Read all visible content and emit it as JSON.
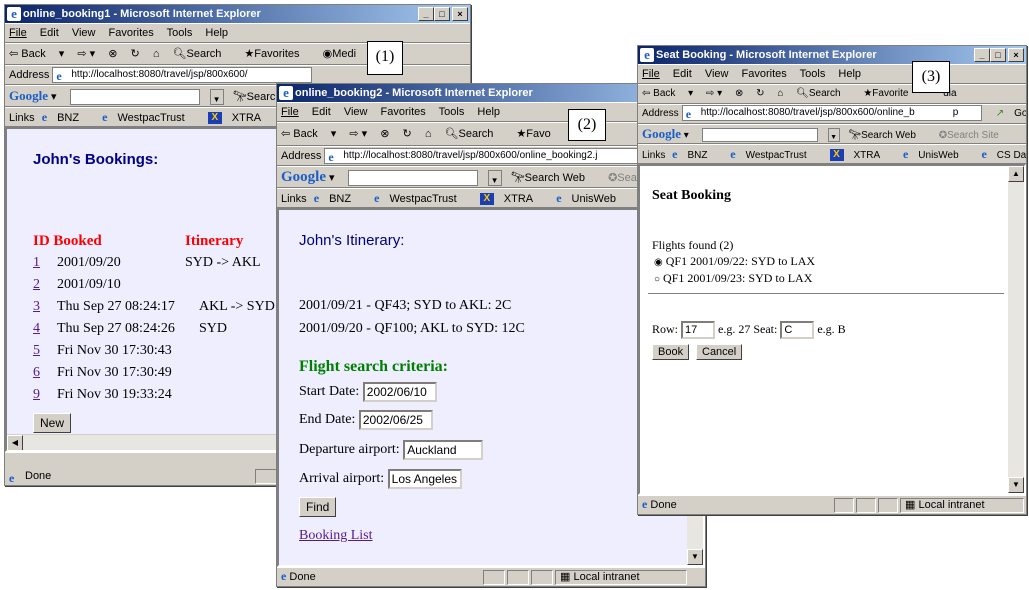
{
  "windows": {
    "w1": {
      "title": "online_booking1 - Microsoft Internet Explorer",
      "menu": [
        "File",
        "Edit",
        "View",
        "Favorites",
        "Tools",
        "Help"
      ],
      "toolbar": {
        "back": "Back",
        "search": "Search",
        "favorites": "Favorites",
        "media": "Medi"
      },
      "address": {
        "label": "Address",
        "url": "http://localhost:8080/travel/jsp/800x600/"
      },
      "google": {
        "logo": "Google",
        "search": "Search"
      },
      "links": {
        "label": "Links",
        "items": [
          "BNZ",
          "WestpacTrust",
          "XTRA"
        ]
      },
      "page": {
        "heading": "John's Bookings:",
        "col_id": "ID Booked",
        "col_itinerary": "Itinerary",
        "rows": [
          {
            "id": "1",
            "booked": "2001/09/20",
            "itinerary": "SYD -> AKL"
          },
          {
            "id": "2",
            "booked": "2001/09/10",
            "itinerary": ""
          },
          {
            "id": "3",
            "booked": "Thu Sep 27 08:24:17",
            "itinerary": "AKL -> SYD"
          },
          {
            "id": "4",
            "booked": "Thu Sep 27 08:24:26",
            "itinerary": "SYD"
          },
          {
            "id": "5",
            "booked": "Fri Nov 30 17:30:43",
            "itinerary": ""
          },
          {
            "id": "6",
            "booked": "Fri Nov 30 17:30:49",
            "itinerary": ""
          },
          {
            "id": "9",
            "booked": "Fri Nov 30 19:33:24",
            "itinerary": ""
          }
        ],
        "new_button": "New"
      },
      "status": "Done",
      "callout": "(1)"
    },
    "w2": {
      "title": "online_booking2 - Microsoft Internet Explorer",
      "menu": [
        "File",
        "Edit",
        "View",
        "Favorites",
        "Tools",
        "Help"
      ],
      "toolbar": {
        "back": "Back",
        "search": "Search",
        "favorites": "Favo",
        "media": "Me"
      },
      "address": {
        "label": "Address",
        "url": "http://localhost:8080/travel/jsp/800x600/online_booking2.j"
      },
      "google": {
        "logo": "Google",
        "search": "Search Web",
        "search_site": "Searc"
      },
      "links": {
        "label": "Links",
        "items": [
          "BNZ",
          "WestpacTrust",
          "XTRA",
          "UnisWeb"
        ]
      },
      "page": {
        "heading": "John's Itinerary:",
        "itinerary": [
          "2001/09/21 - QF43; SYD to AKL: 2C",
          "2001/09/20 - QF100; AKL to SYD: 12C"
        ],
        "criteria_heading": "Flight search criteria:",
        "start_label": "Start Date:",
        "start_value": "2002/06/10",
        "end_label": "End Date:",
        "end_value": "2002/06/25",
        "dep_label": "Departure airport:",
        "dep_value": "Auckland",
        "arr_label": "Arrival airport:",
        "arr_value": "Los Angeles",
        "find_button": "Find",
        "booking_list_link": "Booking List"
      },
      "status": "Done",
      "zone": "Local intranet",
      "callout": "(2)"
    },
    "w3": {
      "title": "Seat Booking - Microsoft Internet Explorer",
      "menu": [
        "File",
        "Edit",
        "View",
        "Favorites",
        "Tools",
        "Help"
      ],
      "toolbar": {
        "back": "Back",
        "search": "Search",
        "favorites": "Favorite",
        "media": "dia"
      },
      "address": {
        "label": "Address",
        "url": "http://localhost:8080/travel/jsp/800x600/online_b",
        "url_tail": "p",
        "go": "Go"
      },
      "google": {
        "logo": "Google",
        "search": "Search Web",
        "search_site": "Search Site"
      },
      "links": {
        "label": "Links",
        "items": [
          "BNZ",
          "WestpacTrust",
          "XTRA",
          "UnisWeb",
          "CS Databases"
        ]
      },
      "page": {
        "heading": "Seat Booking",
        "found": "Flights found (2)",
        "flights": [
          "QF1 2001/09/22: SYD to LAX",
          "QF1 2001/09/23: SYD to LAX"
        ],
        "row_label": "Row:",
        "row_value": "17",
        "row_hint": "e.g. 27",
        "seat_label": "Seat:",
        "seat_value": "C",
        "seat_hint": "e.g. B",
        "book_button": "Book",
        "cancel_button": "Cancel"
      },
      "status": "Done",
      "zone": "Local intranet",
      "callout": "(3)"
    }
  },
  "colors": {
    "title_bar": "#0a246a",
    "page_bg_lavender": "#eeeeff",
    "red_heading": "#ff0000",
    "green_heading": "#008000",
    "blue_heading": "#000080",
    "link": "#551a8b"
  }
}
